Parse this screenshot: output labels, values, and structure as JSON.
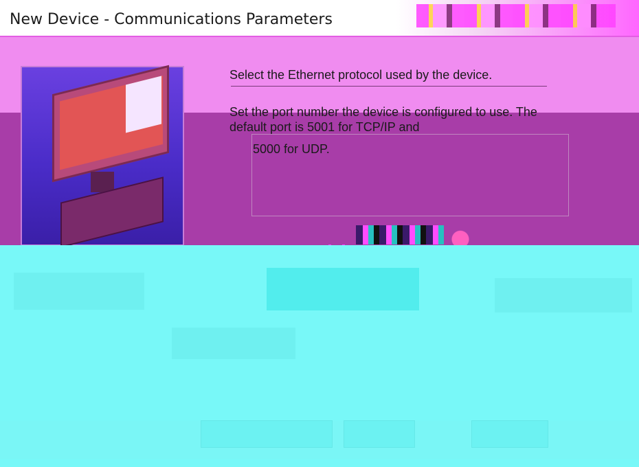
{
  "window": {
    "title": "New Device - Communications Parameters"
  },
  "main": {
    "instruction_line_1": "Select the Ethernet protocol used by the device.",
    "instruction_line_2": "Set the port number the device is configured to use. The default port is 5001 for TCP/IP and",
    "instruction_line_3": "5000 for UDP."
  },
  "colors": {
    "title_bg": "#ffffff",
    "dialog_bg": "#f08cf0",
    "lower_bg": "#78f8f8"
  }
}
